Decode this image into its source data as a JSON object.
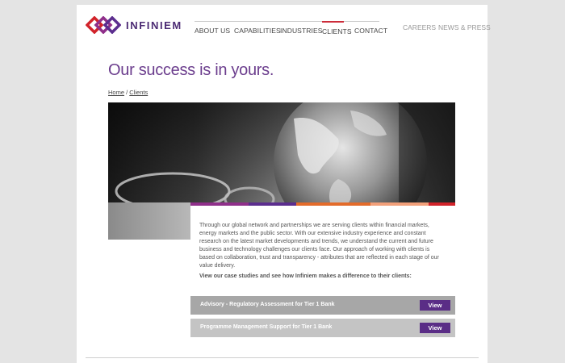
{
  "brand": {
    "name": "INFINIEM",
    "logo_icon": "infinity-knot-logo"
  },
  "nav": {
    "items": [
      {
        "label": "ABOUT US",
        "active": false
      },
      {
        "label": "CAPABILITIES",
        "active": false
      },
      {
        "label": "INDUSTRIES",
        "active": false
      },
      {
        "label": "CLIENTS",
        "active": true
      },
      {
        "label": "CONTACT",
        "active": false
      }
    ],
    "utility": [
      {
        "label": "CAREERS"
      },
      {
        "label": "NEWS & PRESS"
      }
    ]
  },
  "page": {
    "title": "Our success is in yours.",
    "breadcrumb": {
      "home": "Home",
      "separator": " / ",
      "current": "Clients"
    }
  },
  "hero": {
    "image": "glass-globe-and-eyeglasses-photo"
  },
  "accent_colors": [
    "#8f2f8a",
    "#5b2d8e",
    "#e36b2a",
    "#f2a07a",
    "#d1232a"
  ],
  "intro": {
    "text": "Through our global network and partnerships we are serving clients within financial markets, energy markets and the public sector. With our extensive industry experience and constant research on the latest market developments and trends, we understand the current and future business and technology challenges our clients face. Our approach of working with clients is based on collaboration, trust and transparency - attributes that are reflected in each stage of our value delivery.",
    "cta": "View our case studies and see how Infiniem makes a difference to their clients:"
  },
  "case_studies": [
    {
      "title": "Advisory - Regulatory Assessment for Tier 1 Bank",
      "button": "View"
    },
    {
      "title": "Programme Management Support for Tier 1 Bank",
      "button": "View"
    }
  ]
}
